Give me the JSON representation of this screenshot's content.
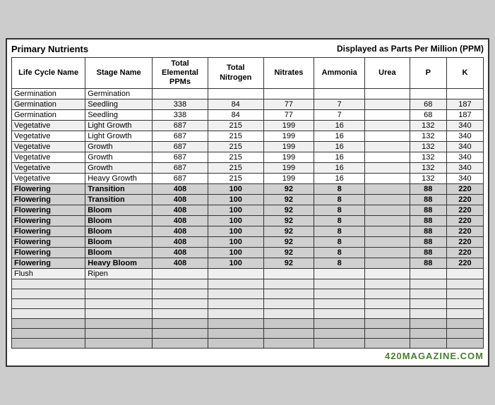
{
  "header": {
    "title": "Primary Nutrients",
    "subtitle": "Displayed as Parts Per Million (PPM)"
  },
  "columns": [
    "Life Cycle Name",
    "Stage Name",
    "Total Elemental PPMs",
    "Total Nitrogen",
    "Nitrates",
    "Ammonia",
    "Urea",
    "P",
    "K"
  ],
  "rows": [
    {
      "lifecycle": "Germination",
      "stage": "Germination",
      "total_ppm": "",
      "total_n": "",
      "nitrates": "",
      "ammonia": "",
      "urea": "",
      "p": "",
      "k": "",
      "type": "normal"
    },
    {
      "lifecycle": "Germination",
      "stage": "Seedling",
      "total_ppm": "338",
      "total_n": "84",
      "nitrates": "77",
      "ammonia": "7",
      "urea": "",
      "p": "68",
      "k": "187",
      "type": "normal"
    },
    {
      "lifecycle": "Germination",
      "stage": "Seedling",
      "total_ppm": "338",
      "total_n": "84",
      "nitrates": "77",
      "ammonia": "7",
      "urea": "",
      "p": "68",
      "k": "187",
      "type": "normal"
    },
    {
      "lifecycle": "Vegetative",
      "stage": "Light Growth",
      "total_ppm": "687",
      "total_n": "215",
      "nitrates": "199",
      "ammonia": "16",
      "urea": "",
      "p": "132",
      "k": "340",
      "type": "normal"
    },
    {
      "lifecycle": "Vegetative",
      "stage": "Light Growth",
      "total_ppm": "687",
      "total_n": "215",
      "nitrates": "199",
      "ammonia": "16",
      "urea": "",
      "p": "132",
      "k": "340",
      "type": "normal"
    },
    {
      "lifecycle": "Vegetative",
      "stage": "Growth",
      "total_ppm": "687",
      "total_n": "215",
      "nitrates": "199",
      "ammonia": "16",
      "urea": "",
      "p": "132",
      "k": "340",
      "type": "normal"
    },
    {
      "lifecycle": "Vegetative",
      "stage": "Growth",
      "total_ppm": "687",
      "total_n": "215",
      "nitrates": "199",
      "ammonia": "16",
      "urea": "",
      "p": "132",
      "k": "340",
      "type": "normal"
    },
    {
      "lifecycle": "Vegetative",
      "stage": "Growth",
      "total_ppm": "687",
      "total_n": "215",
      "nitrates": "199",
      "ammonia": "16",
      "urea": "",
      "p": "132",
      "k": "340",
      "type": "normal"
    },
    {
      "lifecycle": "Vegetative",
      "stage": "Heavy Growth",
      "total_ppm": "687",
      "total_n": "215",
      "nitrates": "199",
      "ammonia": "16",
      "urea": "",
      "p": "132",
      "k": "340",
      "type": "normal"
    },
    {
      "lifecycle": "Flowering",
      "stage": "Transition",
      "total_ppm": "408",
      "total_n": "100",
      "nitrates": "92",
      "ammonia": "8",
      "urea": "",
      "p": "88",
      "k": "220",
      "type": "flowering"
    },
    {
      "lifecycle": "Flowering",
      "stage": "Transition",
      "total_ppm": "408",
      "total_n": "100",
      "nitrates": "92",
      "ammonia": "8",
      "urea": "",
      "p": "88",
      "k": "220",
      "type": "flowering"
    },
    {
      "lifecycle": "Flowering",
      "stage": "Bloom",
      "total_ppm": "408",
      "total_n": "100",
      "nitrates": "92",
      "ammonia": "8",
      "urea": "",
      "p": "88",
      "k": "220",
      "type": "flowering"
    },
    {
      "lifecycle": "Flowering",
      "stage": "Bloom",
      "total_ppm": "408",
      "total_n": "100",
      "nitrates": "92",
      "ammonia": "8",
      "urea": "",
      "p": "88",
      "k": "220",
      "type": "flowering"
    },
    {
      "lifecycle": "Flowering",
      "stage": "Bloom",
      "total_ppm": "408",
      "total_n": "100",
      "nitrates": "92",
      "ammonia": "8",
      "urea": "",
      "p": "88",
      "k": "220",
      "type": "flowering"
    },
    {
      "lifecycle": "Flowering",
      "stage": "Bloom",
      "total_ppm": "408",
      "total_n": "100",
      "nitrates": "92",
      "ammonia": "8",
      "urea": "",
      "p": "88",
      "k": "220",
      "type": "flowering"
    },
    {
      "lifecycle": "Flowering",
      "stage": "Bloom",
      "total_ppm": "408",
      "total_n": "100",
      "nitrates": "92",
      "ammonia": "8",
      "urea": "",
      "p": "88",
      "k": "220",
      "type": "flowering"
    },
    {
      "lifecycle": "Flowering",
      "stage": "Heavy Bloom",
      "total_ppm": "408",
      "total_n": "100",
      "nitrates": "92",
      "ammonia": "8",
      "urea": "",
      "p": "88",
      "k": "220",
      "type": "flowering"
    },
    {
      "lifecycle": "Flush",
      "stage": "Ripen",
      "total_ppm": "",
      "total_n": "",
      "nitrates": "",
      "ammonia": "",
      "urea": "",
      "p": "",
      "k": "",
      "type": "normal"
    }
  ],
  "empty_rows": 7,
  "watermark": "420MAGAZINE.COM"
}
